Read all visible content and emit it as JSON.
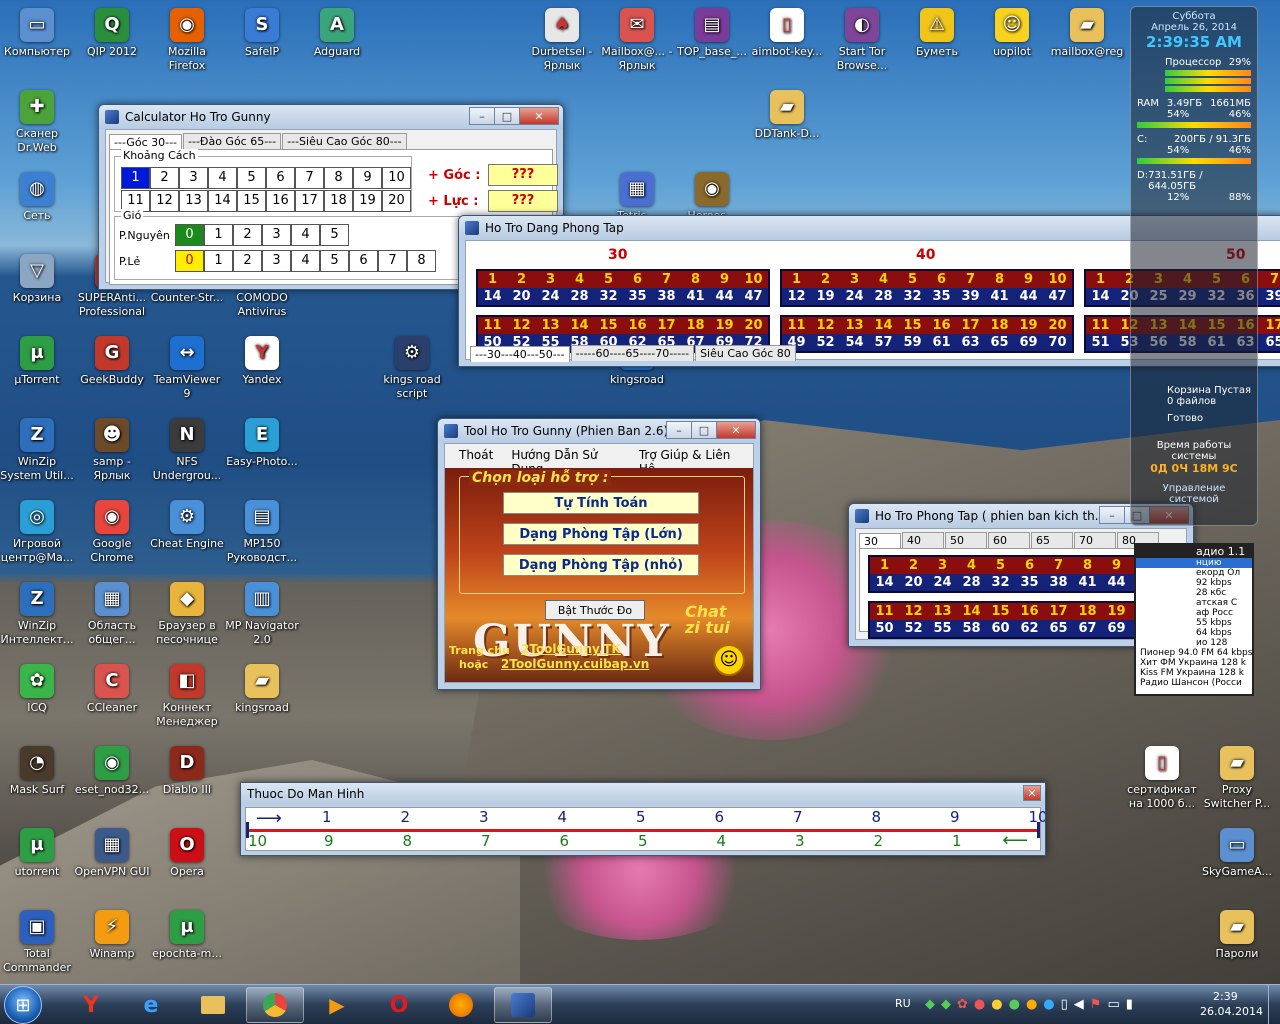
{
  "desktop_icons": [
    {
      "label": "Компьютер",
      "glyph": "▭",
      "bg": "#5b8fd0"
    },
    {
      "label": "QIP 2012",
      "glyph": "Q",
      "bg": "#2a8f3c"
    },
    {
      "label": "Mozilla Firefox",
      "glyph": "◉",
      "bg": "#e66000"
    },
    {
      "label": "SafeIP",
      "glyph": "S",
      "bg": "#3a7bd5"
    },
    {
      "label": "Adguard",
      "glyph": "A",
      "bg": "#3aa57a"
    },
    {
      "label": "Durbetsel - Ярлык",
      "glyph": "♠",
      "bg": "#e7e7e7"
    },
    {
      "label": "Mailbox@... - Ярлык",
      "glyph": "✉",
      "bg": "#d9534f"
    },
    {
      "label": "TOP_base_...",
      "glyph": "▤",
      "bg": "#7a3c9a"
    },
    {
      "label": "aimbot-key...",
      "glyph": "▯",
      "bg": "#ffffff"
    },
    {
      "label": "Start Tor Browse...",
      "glyph": "◐",
      "bg": "#7d4698"
    },
    {
      "label": "Буметь",
      "glyph": "⚠",
      "bg": "#f0c419"
    },
    {
      "label": "uopilot",
      "glyph": "☺",
      "bg": "#f7d21e"
    },
    {
      "label": "mailbox@reg",
      "glyph": "▰",
      "bg": "#e8c15d"
    },
    {
      "label": "Сканер Dr.Web",
      "glyph": "✚",
      "bg": "#4ba33a"
    },
    {
      "label": "Сеть",
      "glyph": "◍",
      "bg": "#3d7fd1"
    },
    {
      "label": "Корзина",
      "glyph": "▽",
      "bg": "#8aa6c3"
    },
    {
      "label": "SUPERAnti... Professional",
      "glyph": "S",
      "bg": "#c0392b"
    },
    {
      "label": "Counter-Str...",
      "glyph": "✶",
      "bg": "#6c6c6c"
    },
    {
      "label": "COMODO Antivirus",
      "glyph": "C",
      "bg": "#c0392b"
    },
    {
      "label": "µTorrent",
      "glyph": "µ",
      "bg": "#2e9e45"
    },
    {
      "label": "GeekBuddy",
      "glyph": "G",
      "bg": "#c0392b"
    },
    {
      "label": "TeamViewer 9",
      "glyph": "↔",
      "bg": "#1f6fd0"
    },
    {
      "label": "Yandex",
      "glyph": "Y",
      "bg": "#ffffff"
    },
    {
      "label": "kings road script",
      "glyph": "⚙",
      "bg": "#2a3f6b"
    },
    {
      "label": "kingsroad",
      "glyph": "K",
      "bg": "#1f6fd0"
    },
    {
      "label": "WinZip System Util...",
      "glyph": "Z",
      "bg": "#2d6fbd"
    },
    {
      "label": "samp - Ярлык",
      "glyph": "☻",
      "bg": "#6b4a2a"
    },
    {
      "label": "NFS Undergrou...",
      "glyph": "N",
      "bg": "#3b3b3b"
    },
    {
      "label": "Easy-Photo...",
      "glyph": "E",
      "bg": "#2a9fd6"
    },
    {
      "label": "Игровой центр@Ma...",
      "glyph": "◎",
      "bg": "#2a9fd6"
    },
    {
      "label": "Google Chrome",
      "glyph": "◉",
      "bg": "#e8453c"
    },
    {
      "label": "Cheat Engine",
      "glyph": "⚙",
      "bg": "#4a90d9"
    },
    {
      "label": "MP150 Руководст...",
      "glyph": "▤",
      "bg": "#4a90d9"
    },
    {
      "label": "WinZip Интеллект...",
      "glyph": "Z",
      "bg": "#2d6fbd"
    },
    {
      "label": "Область общег...",
      "glyph": "▦",
      "bg": "#5b8fd0"
    },
    {
      "label": "Браузер в песочнице",
      "glyph": "◆",
      "bg": "#e8b43c"
    },
    {
      "label": "MP Navigator 2.0",
      "glyph": "▥",
      "bg": "#4a90d9"
    },
    {
      "label": "ICQ",
      "glyph": "✿",
      "bg": "#3ab54a"
    },
    {
      "label": "CCleaner",
      "glyph": "C",
      "bg": "#d9534f"
    },
    {
      "label": "Коннект Менеджер",
      "glyph": "◧",
      "bg": "#c0392b"
    },
    {
      "label": "kingsroad",
      "glyph": "▰",
      "bg": "#e8c15d"
    },
    {
      "label": "Mask Surf",
      "glyph": "◔",
      "bg": "#4a3a2a"
    },
    {
      "label": "eset_nod32...",
      "glyph": "◉",
      "bg": "#2e9e45"
    },
    {
      "label": "Diablo III",
      "glyph": "D",
      "bg": "#8b2a1a"
    },
    {
      "label": "utorrent",
      "glyph": "µ",
      "bg": "#2e9e45"
    },
    {
      "label": "OpenVPN GUI",
      "glyph": "▦",
      "bg": "#3b5a8a"
    },
    {
      "label": "Opera",
      "glyph": "O",
      "bg": "#cc0f16"
    },
    {
      "label": "Total Commander",
      "glyph": "▣",
      "bg": "#2d5fbd"
    },
    {
      "label": "Winamp",
      "glyph": "⚡",
      "bg": "#f39c12"
    },
    {
      "label": "epochta-m...",
      "glyph": "µ",
      "bg": "#2e9e45"
    },
    {
      "label": "DDTank-D...",
      "glyph": "▰",
      "bg": "#e8c15d"
    },
    {
      "label": "Tetris...",
      "glyph": "▦",
      "bg": "#4a6fd0"
    },
    {
      "label": "Heroes...",
      "glyph": "◉",
      "bg": "#8a6a2a"
    },
    {
      "label": "сертификат на 1000 б...",
      "glyph": "▯",
      "bg": "#ffffff"
    },
    {
      "label": "Proxy Switcher P...",
      "glyph": "▰",
      "bg": "#e8c15d"
    },
    {
      "label": "SkyGameA...",
      "glyph": "▭",
      "bg": "#5b8fd0"
    },
    {
      "label": "Пароли",
      "glyph": "▰",
      "bg": "#e8c15d"
    }
  ],
  "calc": {
    "title": "Calculator Ho Tro Gunny",
    "tabs": [
      "---Góc 30---",
      "---Đào Góc 65---",
      "---Siêu Cao Góc 80---"
    ],
    "khoang_label": "Khoảng Cách",
    "row1": [
      "1",
      "2",
      "3",
      "4",
      "5",
      "6",
      "7",
      "8",
      "9",
      "10"
    ],
    "row2": [
      "11",
      "12",
      "13",
      "14",
      "15",
      "16",
      "17",
      "18",
      "19",
      "20"
    ],
    "goc_label": "+ Góc :",
    "goc_val": "???",
    "luc_label": "+ Lực :",
    "luc_val": "???",
    "gio_label": "Gió",
    "pnguyen": "P.Nguyên",
    "ple": "P.Lẻ",
    "pn_vals": [
      "0",
      "1",
      "2",
      "3",
      "4",
      "5"
    ],
    "pl_vals": [
      "0",
      "1",
      "2",
      "3",
      "4",
      "5",
      "6",
      "7",
      "8"
    ]
  },
  "dang": {
    "title": "Ho Tro Dang Phong Tap",
    "headers": [
      "30",
      "40",
      "50"
    ],
    "g30_top": [
      "1",
      "2",
      "3",
      "4",
      "5",
      "6",
      "7",
      "8",
      "9",
      "10"
    ],
    "g30_bot": [
      "14",
      "20",
      "24",
      "28",
      "32",
      "35",
      "38",
      "41",
      "44",
      "47"
    ],
    "g30_top2": [
      "11",
      "12",
      "13",
      "14",
      "15",
      "16",
      "17",
      "18",
      "19",
      "20"
    ],
    "g30_bot2": [
      "50",
      "52",
      "55",
      "58",
      "60",
      "62",
      "65",
      "67",
      "69",
      "72"
    ],
    "g40_top": [
      "1",
      "2",
      "3",
      "4",
      "5",
      "6",
      "7",
      "8",
      "9",
      "10"
    ],
    "g40_bot": [
      "12",
      "19",
      "24",
      "28",
      "32",
      "35",
      "39",
      "41",
      "44",
      "47"
    ],
    "g40_top2": [
      "11",
      "12",
      "13",
      "14",
      "15",
      "16",
      "17",
      "18",
      "19",
      "20"
    ],
    "g40_bot2": [
      "49",
      "52",
      "54",
      "57",
      "59",
      "61",
      "63",
      "65",
      "69",
      "70"
    ],
    "g50_top": [
      "1",
      "2",
      "3",
      "4",
      "5",
      "6",
      "7"
    ],
    "g50_bot": [
      "14",
      "20",
      "25",
      "29",
      "32",
      "36",
      "39"
    ],
    "g50_top2": [
      "11",
      "12",
      "13",
      "14",
      "15",
      "16",
      "17"
    ],
    "g50_bot2": [
      "51",
      "53",
      "56",
      "58",
      "61",
      "63",
      "65"
    ],
    "tabs": [
      "---30---40---50---",
      "-----60----65----70-----",
      "Siêu Cao Góc 80"
    ]
  },
  "tool": {
    "title": "Tool Ho Tro Gunny (Phien Ban 2.6)",
    "menu": [
      "Thoát",
      "Hướng Dẫn Sử Dụng",
      "Trợ Giúp & Liên Hệ"
    ],
    "legend": "Chọn loại hỗ trợ :",
    "btn1": "Tự Tính Toán",
    "btn2": "Dạng Phòng Tập (Lớn)",
    "btn3": "Dạng Phòng Tập (nhỏ)",
    "btn4": "Bật Thước Đo",
    "home1": "Trang chủ",
    "home2": "hoặc",
    "link1": "2ToolGunny.TK",
    "link2": "2ToolGunny.cuibap.vn",
    "gunny": "GUNNY",
    "chat": "Chat zi tui"
  },
  "phong": {
    "title": "Ho Tro Phong Tap ( phien ban kich th...",
    "tabs": [
      "30",
      "40",
      "50",
      "60",
      "65",
      "70",
      "80"
    ],
    "top": [
      "1",
      "2",
      "3",
      "4",
      "5",
      "6",
      "7",
      "8",
      "9",
      "10"
    ],
    "bot": [
      "14",
      "20",
      "24",
      "28",
      "32",
      "35",
      "38",
      "41",
      "44",
      "47"
    ],
    "top2": [
      "11",
      "12",
      "13",
      "14",
      "15",
      "16",
      "17",
      "18",
      "19",
      "20"
    ],
    "bot2": [
      "50",
      "52",
      "55",
      "58",
      "60",
      "62",
      "65",
      "67",
      "69",
      "72"
    ]
  },
  "ruler": {
    "title": "Thuoc Do Man Hinh",
    "top": [
      "1",
      "2",
      "3",
      "4",
      "5",
      "6",
      "7",
      "8",
      "9",
      "10"
    ],
    "bot": [
      "10",
      "9",
      "8",
      "7",
      "6",
      "5",
      "4",
      "3",
      "2",
      "1"
    ]
  },
  "gadget": {
    "day": "Суббота",
    "date": "Апрель 26, 2014",
    "time": "2:39:35 AM",
    "cpu_label": "Процессор",
    "cpu_val": "29%",
    "ram_label": "RAM",
    "ram_a": "3.49ГБ",
    "ram_b": "1661МБ",
    "ram_c": "54%",
    "ram_d": "46%",
    "c_label": "C:",
    "c_a": "200ГБ / 91.3ГБ",
    "c_b": "54%",
    "c_c": "46%",
    "d_label": "D:",
    "d_a": "731.51ГБ / 644.05ГБ",
    "d_b": "12%",
    "d_c": "88%",
    "bin_label": "Корзина",
    "bin_files": "0 файлов",
    "bin_state": "Пустая",
    "ready": "Готово",
    "uptime_label": "Время работы системы",
    "uptime": "0Д 0Ч 18М 9С",
    "manage": "Управление системой"
  },
  "radio": {
    "title": "адио 1.1",
    "items": [
      "нцию",
      "екорд Ол",
      "92 kbps",
      "28 кбс",
      "атская С",
      "аф Росс",
      "55 kbps",
      "64 kbps",
      "ио 128",
      "Пионер 94.0 FM 64 kbps",
      "Хит ФМ Украина 128 k",
      "Kiss FM Украина 128 k",
      "Радио Шансон (Росси"
    ]
  },
  "tray": {
    "lang": "RU",
    "time": "2:39",
    "date": "26.04.2014"
  }
}
